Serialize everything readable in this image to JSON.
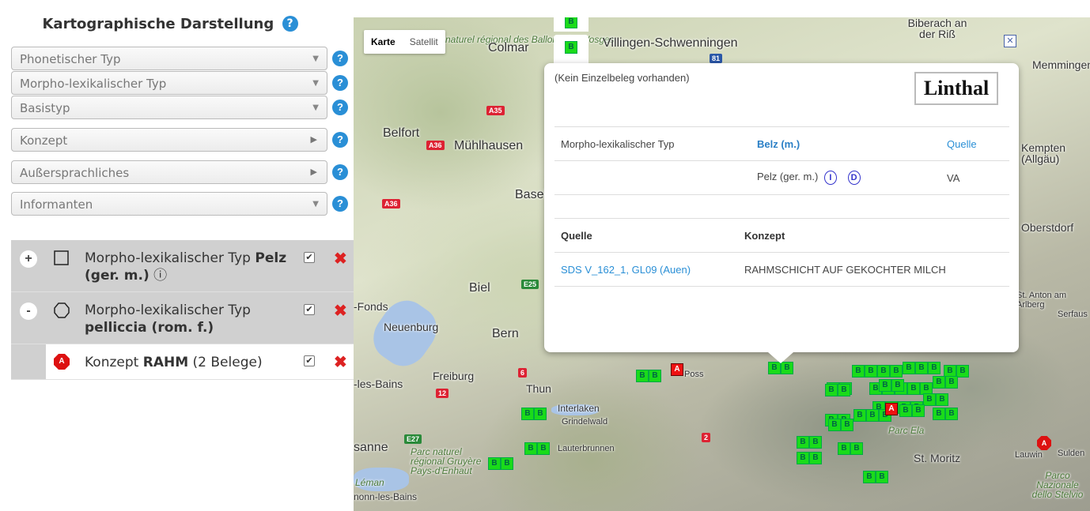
{
  "panel": {
    "title": "Kartographische Darstellung",
    "title_help": "?",
    "filters": [
      {
        "label": "Phonetischer Typ",
        "control": "dropdown"
      },
      {
        "label": "Morpho-lexikalischer Typ",
        "control": "dropdown"
      },
      {
        "label": "Basistyp",
        "control": "dropdown"
      },
      {
        "label": "Konzept",
        "control": "expand"
      },
      {
        "label": "Außersprachliches",
        "control": "expand"
      },
      {
        "label": "Informanten",
        "control": "dropdown"
      }
    ],
    "help_symbol": "?"
  },
  "legend": [
    {
      "toggle": "+",
      "prefix": "Morpho-lexikalischer Typ ",
      "bold": "Pelz (ger. m.)",
      "info": "ⓘ",
      "symbol": "square-icon",
      "checked": "✔",
      "delete": "✖"
    },
    {
      "toggle": "-",
      "prefix": "Morpho-lexikalischer Typ ",
      "bold": "pelliccia (rom. f.)",
      "symbol": "circle-icon",
      "checked": "✔",
      "delete": "✖"
    },
    {
      "prefix": "Konzept ",
      "bold": "RAHM",
      "suffix": " (2 Belege)",
      "symbol": "red-octagon-icon",
      "symbol_text": "A",
      "checked": "✔",
      "delete": "✖"
    }
  ],
  "map": {
    "type_buttons": [
      "Karte",
      "Satellit"
    ],
    "active_type": "Karte",
    "places": [
      "Colmar",
      "Villingen-Schwenningen",
      "Biberach an der Riß",
      "Mühlhausen",
      "Belfort",
      "Basel",
      "Biel",
      "Bern",
      "Neuenburg",
      "Freiburg",
      "Thun",
      "Interlaken",
      "Grindelwald",
      "Lauterbrunnen",
      "St. Moritz",
      "Oberstdorf",
      "St. Anton am Arlberg",
      "-les-Bains",
      "-Fonds",
      "sanne",
      "Parc Ela",
      "Lauwin",
      "Sulden",
      "Parco Nazionale dello Stelvio",
      "Parc naturel régional Gruyère Pays-d'Enhaut",
      "Parc naturel régional des Ballons des Vosges",
      "Memmingen",
      "Kempten (Allgäu)",
      "Serfaus",
      "nonn-les-Bains",
      "Léman",
      "Poss"
    ],
    "roads": [
      "A35",
      "A36",
      "A36",
      "E25",
      "E27",
      "12",
      "6",
      "2",
      "81"
    ],
    "marker_b": "B",
    "marker_a": "A",
    "close": "✕"
  },
  "popup": {
    "note": "(Kein Einzelbeleg vorhanden)",
    "place": "Linthal",
    "row1": {
      "col1": "Morpho-lexikalischer Typ",
      "col2": "Belz (m.)",
      "col3": "Quelle"
    },
    "row2": {
      "col2": "Pelz (ger. m.)",
      "icon1": "I",
      "icon2": "D",
      "col3": "VA"
    },
    "head": {
      "col1": "Quelle",
      "col2": "Konzept"
    },
    "row3": {
      "col1": "SDS V_162_1, GL09 (Auen)",
      "col2": "RAHMSCHICHT AUF GEKOCHTER MILCH"
    }
  }
}
